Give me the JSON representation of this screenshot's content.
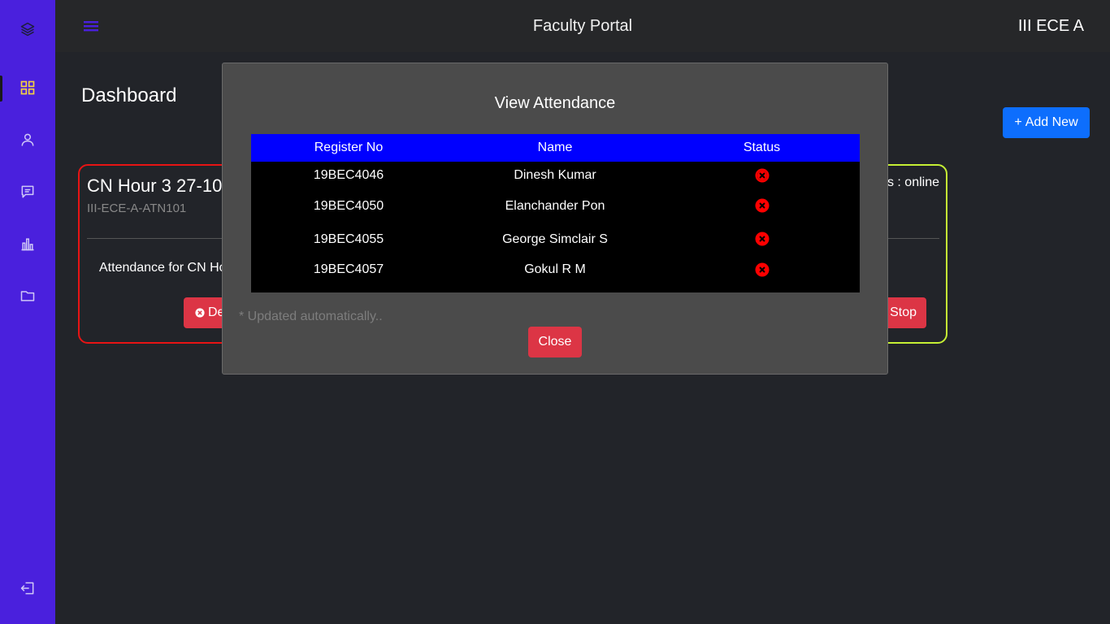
{
  "topbar": {
    "title": "Faculty Portal",
    "class_label": "III ECE A"
  },
  "sidebar": {
    "items": [
      {
        "icon": "layers-icon"
      },
      {
        "icon": "dashboard-grid-icon",
        "active": true
      },
      {
        "icon": "user-icon"
      },
      {
        "icon": "message-icon"
      },
      {
        "icon": "bar-chart-icon"
      },
      {
        "icon": "folder-icon"
      },
      {
        "icon": "logout-icon"
      }
    ]
  },
  "page": {
    "title": "Dashboard",
    "add_button": "Add New"
  },
  "cards": {
    "red": {
      "title": "CN Hour 3 27-10",
      "code": "III-ECE-A-ATN101",
      "text": "Attendance for CN Ho",
      "delete_label": "De"
    },
    "green": {
      "status": "us : online",
      "stop_label": "Stop"
    }
  },
  "modal": {
    "title": "View Attendance",
    "columns": [
      "Register No",
      "Name",
      "Status"
    ],
    "rows": [
      {
        "reg": "19BEC4046",
        "name": "Dinesh Kumar",
        "status": "absent"
      },
      {
        "reg": "19BEC4050",
        "name": "Elanchander Pon",
        "status": "absent"
      },
      {
        "reg": "19BEC4055",
        "name": "George Simclair S",
        "status": "absent"
      },
      {
        "reg": "19BEC4057",
        "name": "Gokul R M",
        "status": "absent"
      }
    ],
    "note": "* Updated automatically..",
    "close_label": "Close"
  },
  "colors": {
    "sidebar": "#4a20dd",
    "accent_blue": "#0d6efd",
    "table_header": "#0000ff",
    "danger": "#dc3545",
    "card_red_border": "#e81414",
    "card_green_border": "#c6f034"
  }
}
